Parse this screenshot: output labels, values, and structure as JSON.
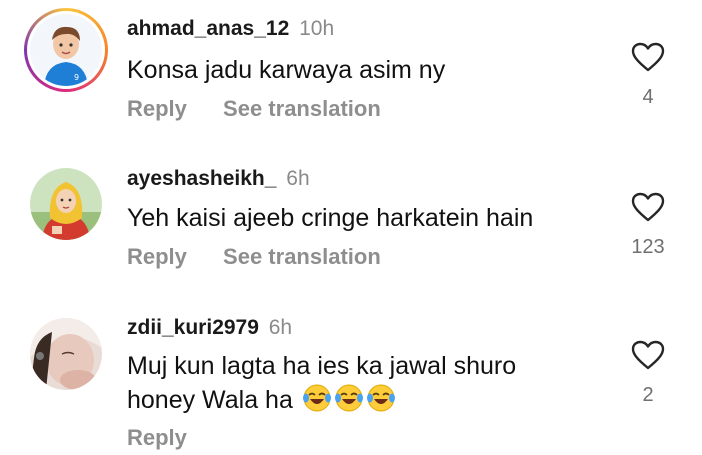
{
  "comments": [
    {
      "username": "ahmad_anas_12",
      "time": "10h",
      "text": "Konsa jadu karwaya asim ny",
      "reply_label": "Reply",
      "translate_label": "See translation",
      "likes": "4",
      "avatar_icon": "avatar-boy-blue-shirt",
      "has_story_ring": true
    },
    {
      "username": "ayeshasheikh_",
      "time": "6h",
      "text": "Yeh kaisi ajeeb cringe harkatein hain",
      "reply_label": "Reply",
      "translate_label": "See translation",
      "likes": "123",
      "avatar_icon": "avatar-girl-hijab-cartoon"
    },
    {
      "username": "zdii_kuri2979",
      "time": "6h",
      "text_line1": "Muj kun lagta ha ies ka jawal  shuro",
      "text_line2": "honey Wala ha",
      "emojis": [
        "laughing-tears-emoji",
        "laughing-tears-emoji",
        "laughing-tears-emoji"
      ],
      "reply_label": "Reply",
      "likes": "2",
      "avatar_icon": "avatar-girl-photo"
    }
  ],
  "colors": {
    "username": "#1a1a1a",
    "secondary_text": "#8e8e8e",
    "heart_stroke": "#262626"
  }
}
